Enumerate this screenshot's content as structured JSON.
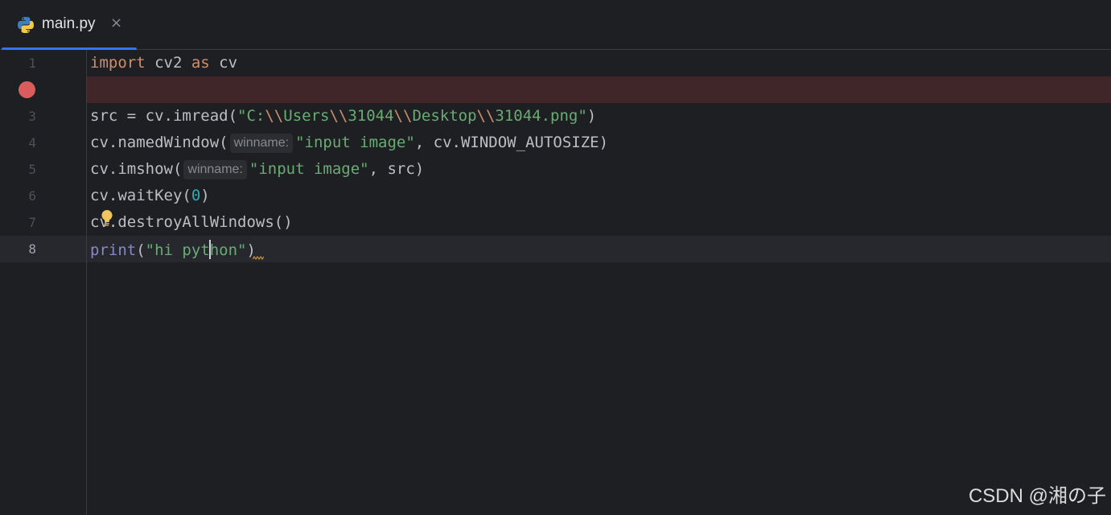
{
  "tab": {
    "filename": "main.py",
    "close_glyph": "×",
    "icon": "python-icon"
  },
  "editor": {
    "lines": [
      {
        "number": "1",
        "text": "import cv2 as cv"
      },
      {
        "number": "",
        "text": "",
        "breakpoint": true
      },
      {
        "number": "3",
        "text": "src = cv.imread(\"C:\\\\Users\\\\31044\\\\Desktop\\\\31044.png\")"
      },
      {
        "number": "4",
        "text": "cv.namedWindow(\"input image\", cv.WINDOW_AUTOSIZE)",
        "hint": "winname:"
      },
      {
        "number": "5",
        "text": "cv.imshow(\"input image\", src)",
        "hint": "winname:"
      },
      {
        "number": "6",
        "text": "cv.waitKey(0)"
      },
      {
        "number": "7",
        "text": "cv.destroyAllWindows()"
      },
      {
        "number": "8",
        "text": "print(\"hi python\")",
        "current": true
      }
    ],
    "tokens": {
      "l1_import": "import",
      "l1_mod": " cv2 ",
      "l1_as": "as",
      "l1_alias": " cv",
      "l3_pre": "src = cv.imread(",
      "l3_s1": "\"C:",
      "l3_e1": "\\\\",
      "l3_s2": "Users",
      "l3_e2": "\\\\",
      "l3_s3": "31044",
      "l3_e3": "\\\\",
      "l3_s4": "Desktop",
      "l3_e4": "\\\\",
      "l3_s5": "31044.png\"",
      "l3_post": ")",
      "l4_pre": "cv.namedWindow(",
      "l4_hint": "winname:",
      "l4_str": "\"input image\"",
      "l4_post": ", cv.WINDOW_AUTOSIZE)",
      "l5_pre": "cv.imshow(",
      "l5_hint": "winname:",
      "l5_str": "\"input image\"",
      "l5_post": ", src)",
      "l6_pre": "cv.waitKey(",
      "l6_num": "0",
      "l6_post": ")",
      "l7": "cv.destroyAllWindows()",
      "l8_fn": "print",
      "l8_open": "(",
      "l8_str_a": "\"hi pyt",
      "l8_str_b": "hon\"",
      "l8_close": ")"
    }
  },
  "watermark": "CSDN @湘の子",
  "colors": {
    "background": "#1e1f22",
    "keyword": "#cf8e6d",
    "string": "#6aab73",
    "number": "#2aacb8",
    "builtin": "#8888c6",
    "breakpoint": "#db5c5c",
    "error_line": "#402629",
    "tab_accent": "#3574f0"
  }
}
